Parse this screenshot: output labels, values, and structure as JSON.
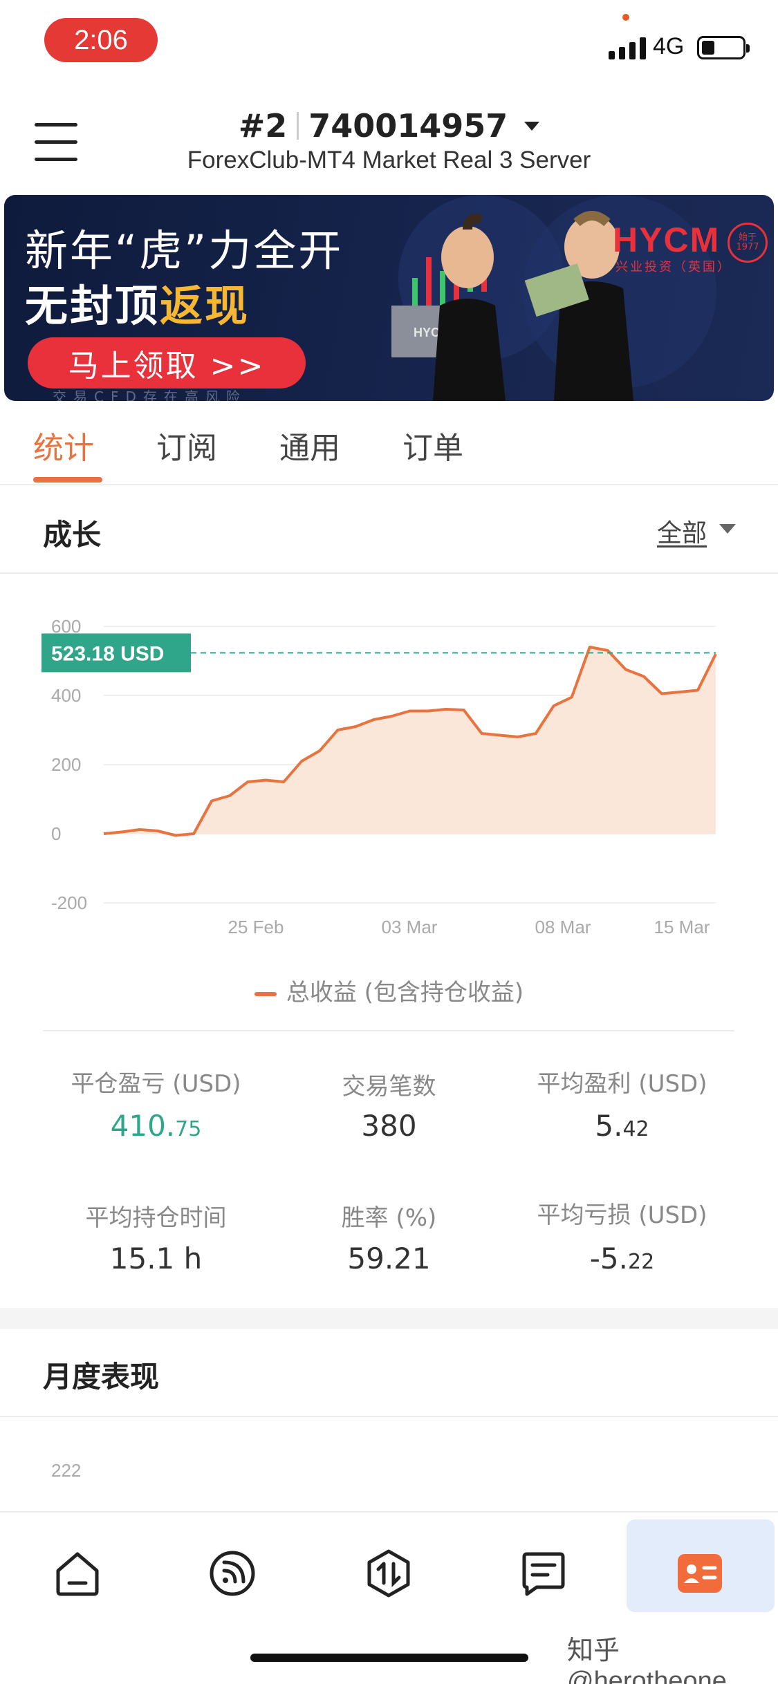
{
  "status_bar": {
    "time": "2:06",
    "network": "4G"
  },
  "header": {
    "account_prefix": "#2",
    "account_number": "740014957",
    "server": "ForexClub-MT4 Market Real 3 Server"
  },
  "banner": {
    "line1": "新年“虎”力全开",
    "line2_a": "无封顶",
    "line2_b": "返现",
    "cta": "马上领取 >>",
    "risk": "交易CFD存在高风险",
    "logo": "HYCM",
    "logo_sub": "兴业投资（英国）",
    "seal": "始于 1977"
  },
  "tabs": [
    {
      "label": "统计",
      "active": true
    },
    {
      "label": "订阅",
      "active": false
    },
    {
      "label": "通用",
      "active": false
    },
    {
      "label": "订单",
      "active": false
    }
  ],
  "growth": {
    "title": "成长",
    "filter": "全部"
  },
  "chart_data": {
    "type": "area",
    "y_ticks": [
      "600",
      "400",
      "200",
      "0",
      "-200"
    ],
    "x_ticks": [
      "25 Feb",
      "03 Mar",
      "08 Mar",
      "15 Mar"
    ],
    "ylim": [
      -200,
      600
    ],
    "current_value": 523.18,
    "current_label": "523.18 USD",
    "series": [
      {
        "name": "总收益 (包含持仓收益)",
        "values": [
          0,
          5,
          12,
          8,
          -5,
          0,
          95,
          110,
          150,
          155,
          150,
          210,
          240,
          300,
          310,
          330,
          340,
          355,
          355,
          360,
          358,
          290,
          285,
          280,
          290,
          370,
          395,
          540,
          530,
          475,
          455,
          405,
          410,
          415,
          520
        ]
      }
    ],
    "colors": {
      "line": "#e8733f",
      "fill": "#fbe3d6",
      "reference": "#2fa68a"
    }
  },
  "stats": [
    {
      "label": "平仓盈亏 (USD)",
      "value_main": "410.",
      "value_dec": "75",
      "highlight": true
    },
    {
      "label": "交易笔数",
      "value_main": "380",
      "value_dec": "",
      "highlight": false
    },
    {
      "label": "平均盈利 (USD)",
      "value_main": "5.",
      "value_dec": "42",
      "highlight": false
    },
    {
      "label": "平均持仓时间",
      "value_main": "15.1 h",
      "value_dec": "",
      "highlight": false
    },
    {
      "label": "胜率 (%)",
      "value_main": "59.21",
      "value_dec": "",
      "highlight": false
    },
    {
      "label": "平均亏损 (USD)",
      "value_main": "-5.",
      "value_dec": "22",
      "highlight": false
    }
  ],
  "monthly": {
    "title": "月度表现",
    "axis_top": "222"
  },
  "bottom_nav": [
    {
      "icon": "home-icon"
    },
    {
      "icon": "signal-feed-icon"
    },
    {
      "icon": "trade-icon"
    },
    {
      "icon": "message-icon"
    },
    {
      "icon": "profile-card-icon",
      "active": true
    }
  ],
  "watermark": "知乎 @herotheone"
}
